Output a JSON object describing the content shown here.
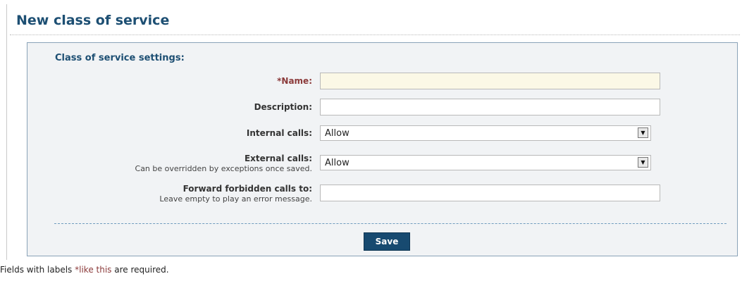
{
  "page": {
    "title": "New class of service"
  },
  "section": {
    "title": "Class of service settings:"
  },
  "form": {
    "name": {
      "label": "*Name:",
      "value": ""
    },
    "description": {
      "label": "Description:",
      "value": ""
    },
    "internal_calls": {
      "label": "Internal calls:",
      "selected": "Allow"
    },
    "external_calls": {
      "label": "External calls:",
      "hint": "Can be overridden by exceptions once saved.",
      "selected": "Allow"
    },
    "forward": {
      "label": "Forward forbidden calls to:",
      "hint": "Leave empty to play an error message.",
      "value": ""
    }
  },
  "actions": {
    "save_label": "Save"
  },
  "footnote": {
    "prefix": "Fields with labels ",
    "example": "*like this",
    "suffix": " are required."
  },
  "colors": {
    "accent": "#1d4f73",
    "required": "#8b3a3a",
    "button": "#174a70"
  }
}
